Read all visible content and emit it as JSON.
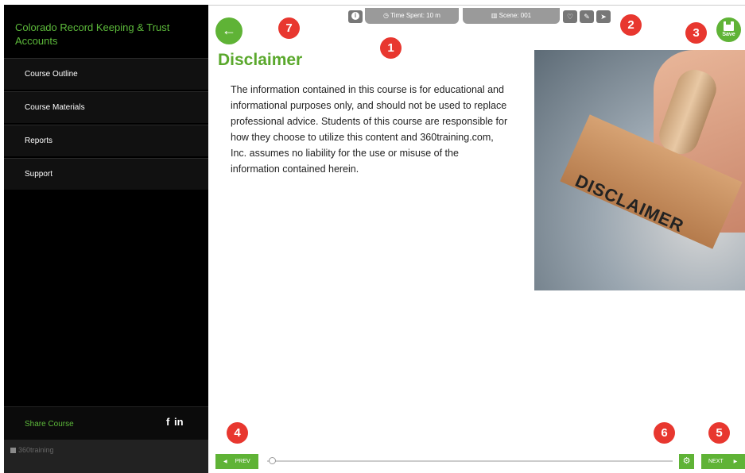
{
  "sidebar": {
    "course_title": "Colorado Record Keeping & Trust Accounts",
    "items": [
      {
        "label": "Course Outline"
      },
      {
        "label": "Course Materials"
      },
      {
        "label": "Reports"
      },
      {
        "label": "Support"
      }
    ],
    "share_label": "Share Course",
    "facebook": "f",
    "linkedin": "in",
    "logo_alt": "360training"
  },
  "toolbar": {
    "time_spent": "Time Spent: 10 m",
    "scene": "Scene: 001",
    "info_glyph": "i"
  },
  "badges": [
    "1",
    "2",
    "3",
    "4",
    "5",
    "6",
    "7"
  ],
  "save_label": "Save",
  "content": {
    "title": "Disclaimer",
    "body": "The information contained in this course is for educational and informational purposes only, and should not be used to replace professional advice. Students of this course are responsible for how they choose to utilize this content and 360training.com, Inc. assumes no liability for the use or misuse of the information contained herein.",
    "image_word": "DISCLAIMER"
  },
  "footer": {
    "prev_label": "PREV",
    "next_label": "NEXT",
    "progress": 0.0
  },
  "colors": {
    "accent_green": "#5fb336",
    "badge_red": "#e8372f",
    "sidebar_bg": "#000000"
  },
  "icons": {
    "back": "arrow-left-icon",
    "save": "floppy-disk-icon",
    "info": "info-icon",
    "time": "clock-icon",
    "scene": "book-icon",
    "bookmark": "heart-icon",
    "notes": "edit-icon",
    "send": "paper-plane-icon",
    "settings": "gear-icon"
  }
}
